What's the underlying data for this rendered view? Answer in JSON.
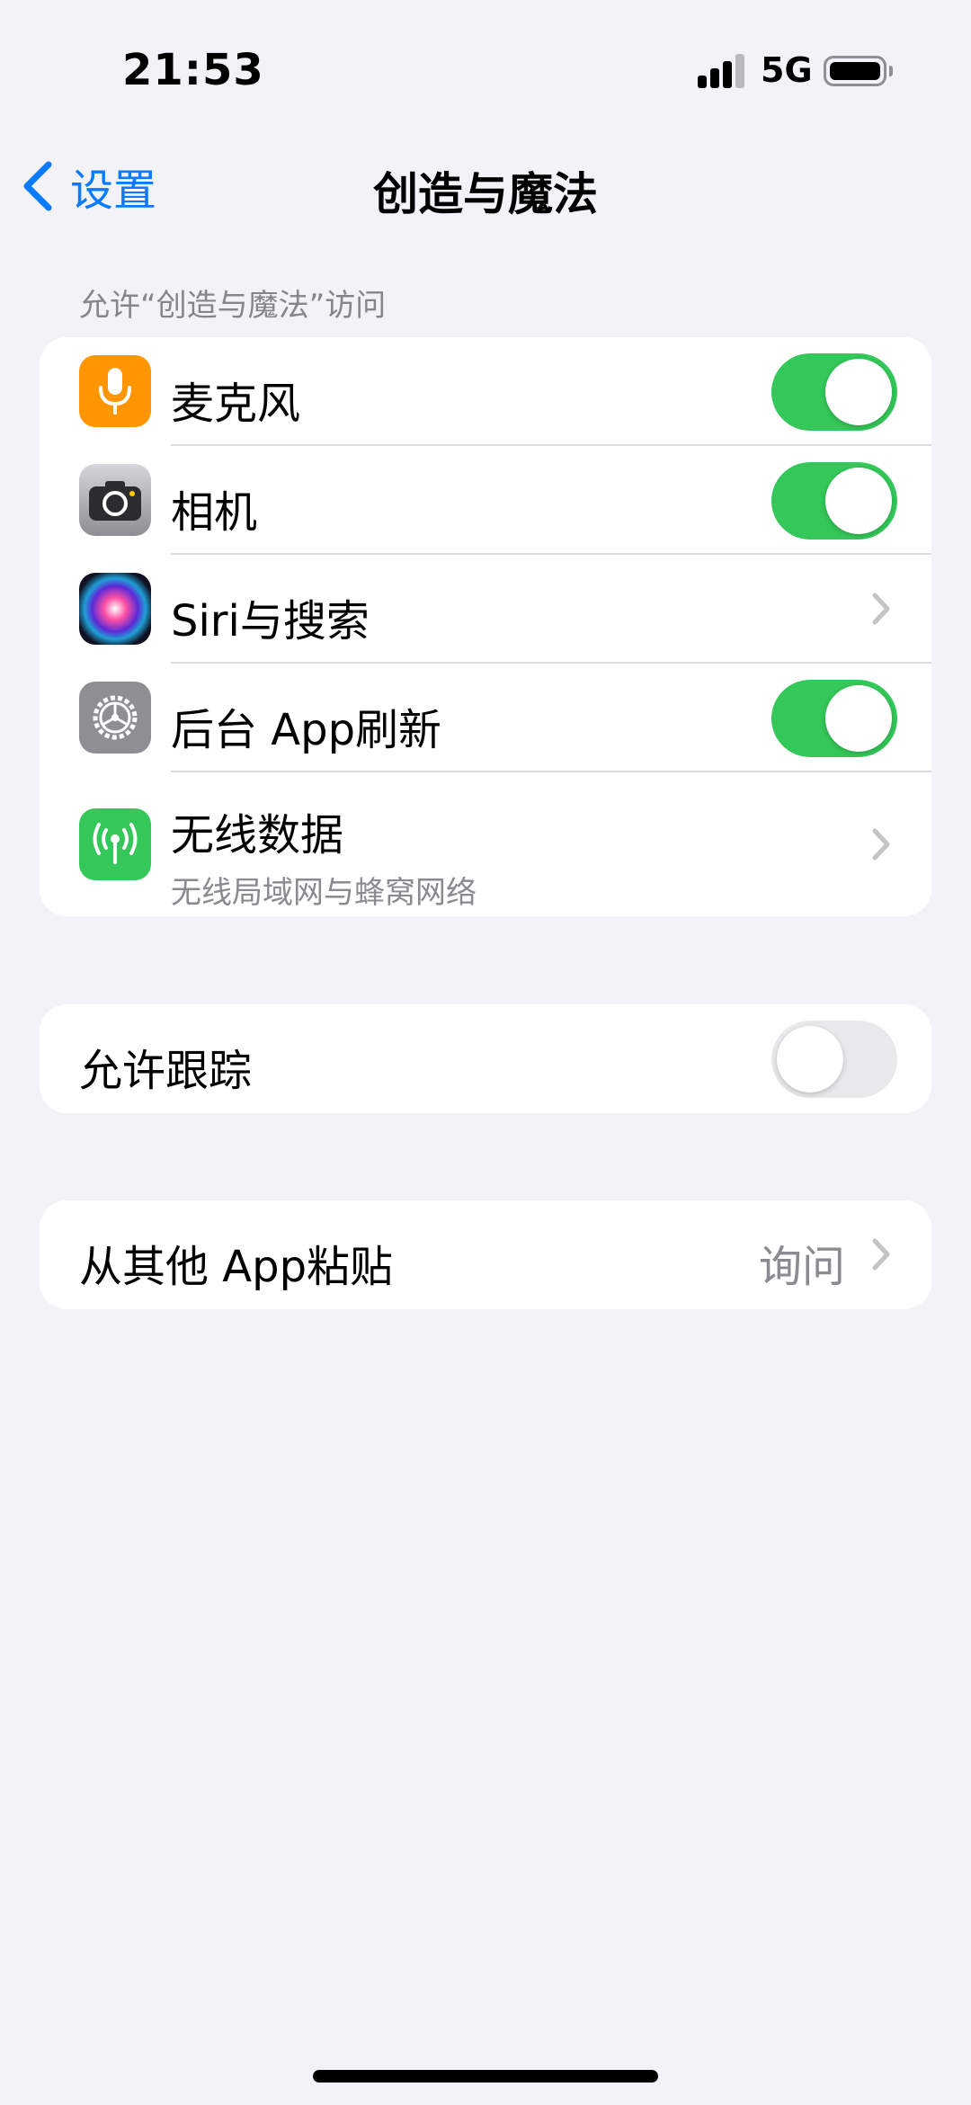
{
  "status_bar": {
    "time": "21:53",
    "network": "5G"
  },
  "nav": {
    "back_label": "设置",
    "title": "创造与魔法"
  },
  "permissions": {
    "header": "允许“创造与魔法”访问",
    "rows": [
      {
        "label": "麦克风",
        "icon": "microphone-icon",
        "icon_color": "#ff9500",
        "control": "toggle",
        "on": true
      },
      {
        "label": "相机",
        "icon": "camera-icon",
        "icon_color": "#8e8e93",
        "control": "toggle",
        "on": true
      },
      {
        "label": "Siri与搜索",
        "icon": "siri-icon",
        "icon_color": "#1c1c2e",
        "control": "chevron"
      },
      {
        "label": "后台 App刷新",
        "icon": "gear-icon",
        "icon_color": "#8e8e93",
        "control": "toggle",
        "on": true
      },
      {
        "label": "无线数据",
        "sublabel": "无线局域网与蜂窝网络",
        "icon": "wireless-data-icon",
        "icon_color": "#34c759",
        "control": "chevron"
      }
    ]
  },
  "tracking": {
    "label": "允许跟踪",
    "on": false
  },
  "paste": {
    "label": "从其他 App粘贴",
    "value": "询问"
  },
  "colors": {
    "accent": "#0a7aff",
    "toggle_on": "#34c759",
    "toggle_off": "#e9e9eb",
    "background": "#f2f2f7"
  }
}
